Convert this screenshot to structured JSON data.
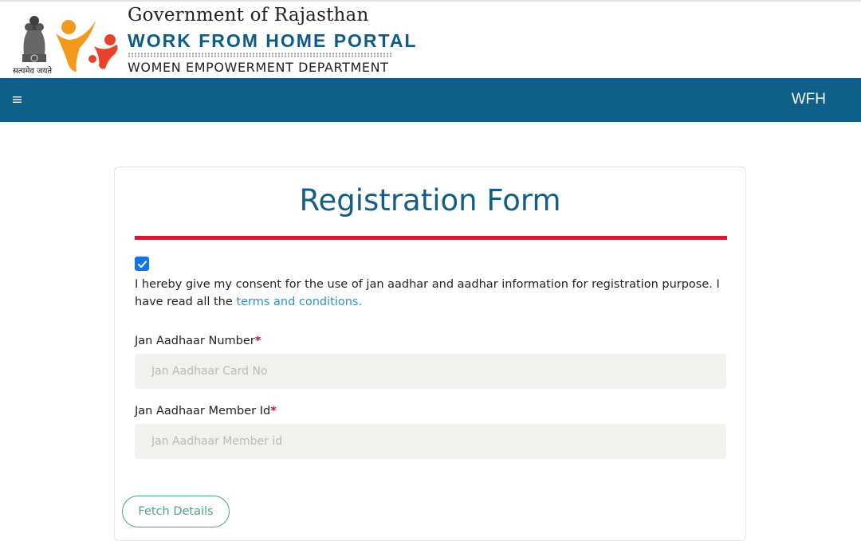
{
  "header": {
    "emblem_caption": "सत्यमेव जयते",
    "gov_title": "Government of Rajasthan",
    "portal_title": "WORK FROM HOME PORTAL",
    "dept_title": "WOMEN EMPOWERMENT DEPARTMENT"
  },
  "navbar": {
    "menu_icon": "hamburger-icon",
    "brand": "WFH",
    "color": "#0f5f8b"
  },
  "form": {
    "title": "Registration Form",
    "consent": {
      "checked": true,
      "text": "I hereby give my consent for the use of jan aadhar and aadhar information for registration purpose. I have read all the ",
      "link_text": "terms and conditions."
    },
    "fields": [
      {
        "label": "Jan Aadhaar Number",
        "required_mark": "*",
        "placeholder": "Jan Aadhaar Card No",
        "value": ""
      },
      {
        "label": "Jan Aadhaar Member Id",
        "required_mark": "*",
        "placeholder": "Jan Aadhaar Member id",
        "value": ""
      }
    ],
    "fetch_button": "Fetch Details"
  },
  "colors": {
    "accent_blue": "#135e84",
    "rule_red": "#d01c37",
    "link_blue": "#2d93c9",
    "button_teal": "#4f9e8f"
  }
}
